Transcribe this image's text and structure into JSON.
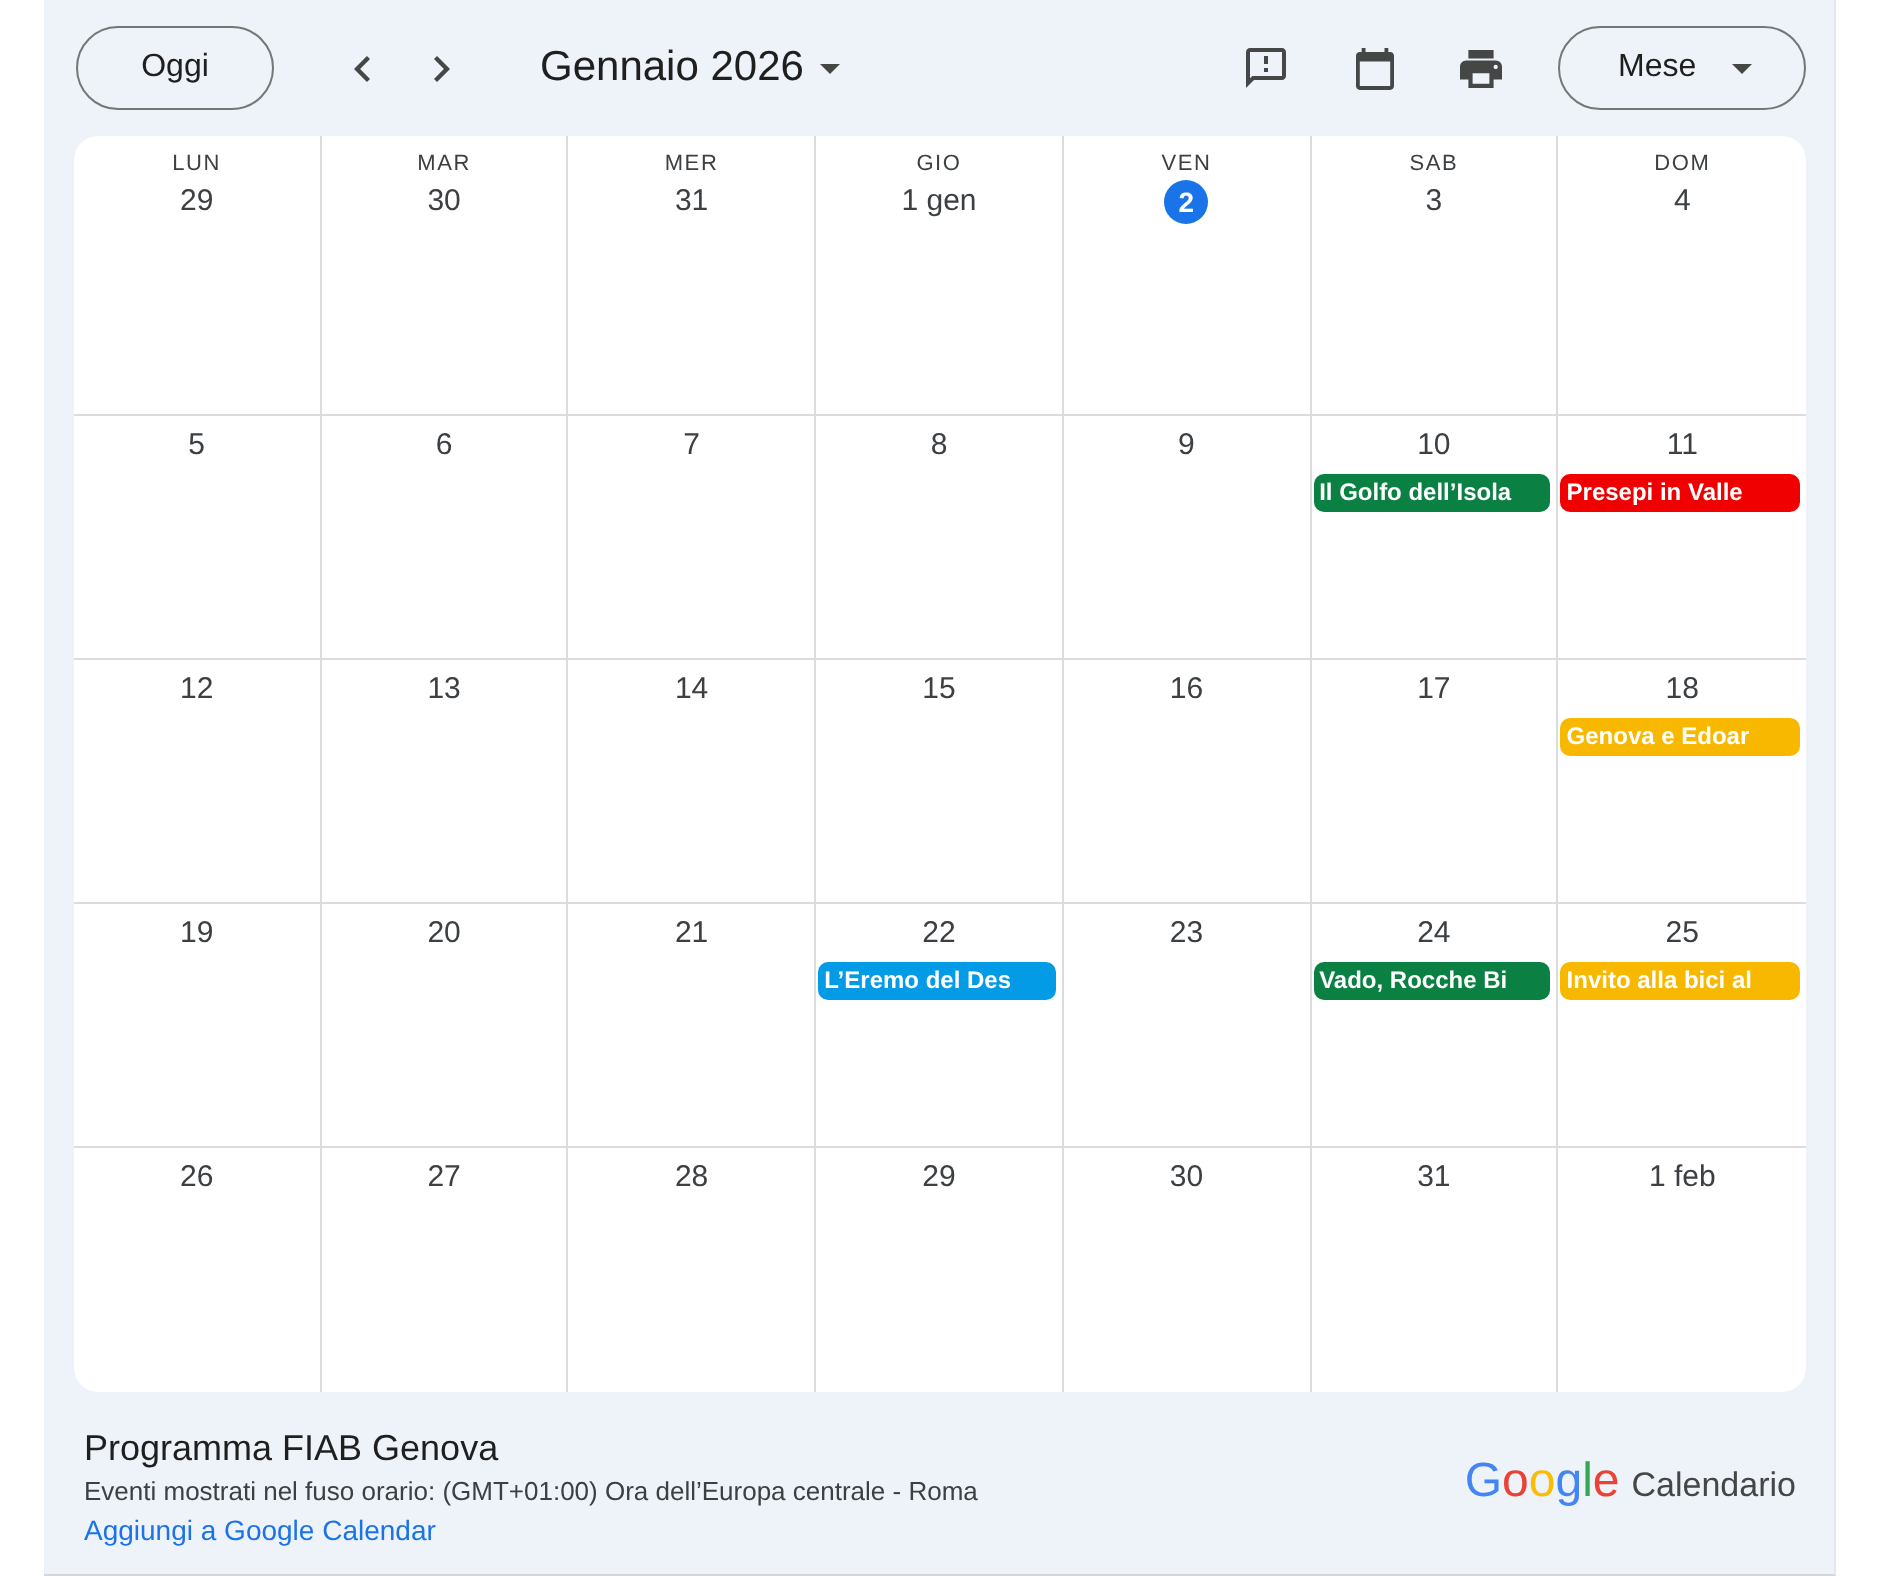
{
  "toolbar": {
    "today_button": "Oggi",
    "title": "Gennaio 2026",
    "view_button": "Mese"
  },
  "calendar": {
    "weekdays": [
      "LUN",
      "MAR",
      "MER",
      "GIO",
      "VEN",
      "SAB",
      "DOM"
    ],
    "weeks": [
      {
        "days": [
          {
            "date": "29",
            "today": false
          },
          {
            "date": "30",
            "today": false
          },
          {
            "date": "31",
            "today": false
          },
          {
            "date": "1 gen",
            "today": false
          },
          {
            "date": "2",
            "today": true
          },
          {
            "date": "3",
            "today": false
          },
          {
            "date": "4",
            "today": false
          }
        ]
      },
      {
        "days": [
          {
            "date": "5",
            "today": false
          },
          {
            "date": "6",
            "today": false
          },
          {
            "date": "7",
            "today": false
          },
          {
            "date": "8",
            "today": false
          },
          {
            "date": "9",
            "today": false
          },
          {
            "date": "10",
            "today": false,
            "events": [
              {
                "title": "Il Golfo dell’Isola",
                "color": "#0b8043"
              }
            ]
          },
          {
            "date": "11",
            "today": false,
            "events": [
              {
                "title": "Presepi in Valle",
                "color": "#f00000"
              }
            ]
          }
        ]
      },
      {
        "days": [
          {
            "date": "12",
            "today": false
          },
          {
            "date": "13",
            "today": false
          },
          {
            "date": "14",
            "today": false
          },
          {
            "date": "15",
            "today": false
          },
          {
            "date": "16",
            "today": false
          },
          {
            "date": "17",
            "today": false
          },
          {
            "date": "18",
            "today": false,
            "events": [
              {
                "title": "Genova e Edoar",
                "color": "#f9b800"
              }
            ]
          }
        ]
      },
      {
        "days": [
          {
            "date": "19",
            "today": false
          },
          {
            "date": "20",
            "today": false
          },
          {
            "date": "21",
            "today": false
          },
          {
            "date": "22",
            "today": false,
            "events": [
              {
                "title": "L’Eremo del Des",
                "color": "#039be5"
              }
            ]
          },
          {
            "date": "23",
            "today": false
          },
          {
            "date": "24",
            "today": false,
            "events": [
              {
                "title": "Vado, Rocche Bi",
                "color": "#0b8043"
              }
            ]
          },
          {
            "date": "25",
            "today": false,
            "events": [
              {
                "title": "Invito alla bici al",
                "color": "#f9b800"
              }
            ]
          }
        ]
      },
      {
        "days": [
          {
            "date": "26",
            "today": false
          },
          {
            "date": "27",
            "today": false
          },
          {
            "date": "28",
            "today": false
          },
          {
            "date": "29",
            "today": false
          },
          {
            "date": "30",
            "today": false
          },
          {
            "date": "31",
            "today": false
          },
          {
            "date": "1 feb",
            "today": false
          }
        ]
      }
    ]
  },
  "footer": {
    "calendar_name": "Programma FIAB Genova",
    "timezone_note": "Eventi mostrati nel fuso orario: (GMT+01:00) Ora dell’Europa centrale - Roma",
    "add_link": "Aggiungi a Google Calendar",
    "brand": {
      "logo": "Google",
      "product": "Calendario"
    }
  }
}
